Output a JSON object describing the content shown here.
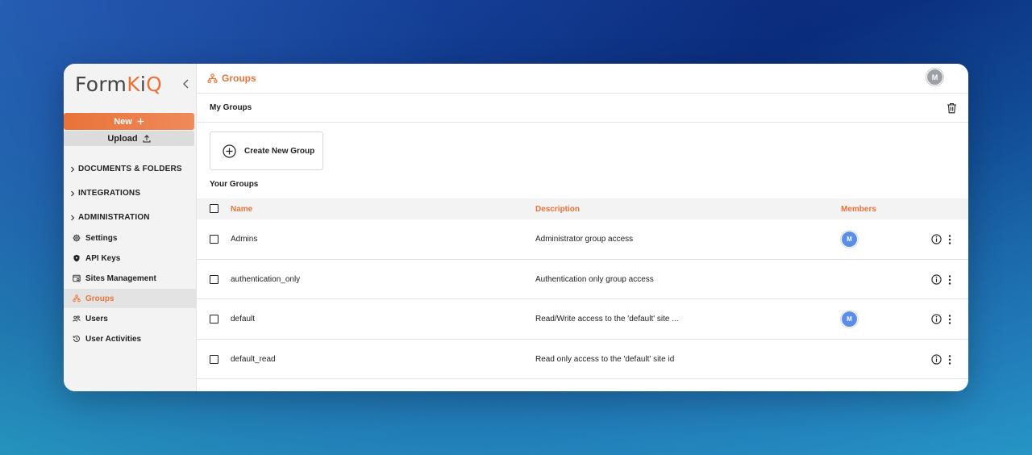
{
  "app": {
    "logo_prefix": "Form",
    "logo_accent_k": "K",
    "logo_mid": "i",
    "logo_accent_q": "Q"
  },
  "sidebar": {
    "new_label": "New",
    "upload_label": "Upload",
    "sections": [
      {
        "label": "DOCUMENTS & FOLDERS"
      },
      {
        "label": "INTEGRATIONS"
      },
      {
        "label": "ADMINISTRATION"
      }
    ],
    "items": [
      {
        "label": "Settings",
        "icon": "gear-icon"
      },
      {
        "label": "API Keys",
        "icon": "shield-icon"
      },
      {
        "label": "Sites Management",
        "icon": "sites-icon"
      },
      {
        "label": "Groups",
        "icon": "groups-icon",
        "active": true
      },
      {
        "label": "Users",
        "icon": "users-icon"
      },
      {
        "label": "User Activities",
        "icon": "history-icon"
      }
    ]
  },
  "header": {
    "title": "Groups",
    "avatar_initial": "M"
  },
  "subheader": {
    "title": "My Groups"
  },
  "create_group_label": "Create New Group",
  "your_groups_label": "Your Groups",
  "table": {
    "columns": [
      "Name",
      "Description",
      "Members"
    ],
    "rows": [
      {
        "name": "Admins",
        "description": "Administrator group access",
        "member": "M"
      },
      {
        "name": "authentication_only",
        "description": "Authentication only group access",
        "member": ""
      },
      {
        "name": "default",
        "description": "Read/Write access to the 'default' site ...",
        "member": "M"
      },
      {
        "name": "default_read",
        "description": "Read only access to the 'default' site id",
        "member": ""
      }
    ]
  },
  "colors": {
    "accent": "#e8733a",
    "member_avatar": "#5b8ee6",
    "user_avatar": "#9aa0a6"
  }
}
